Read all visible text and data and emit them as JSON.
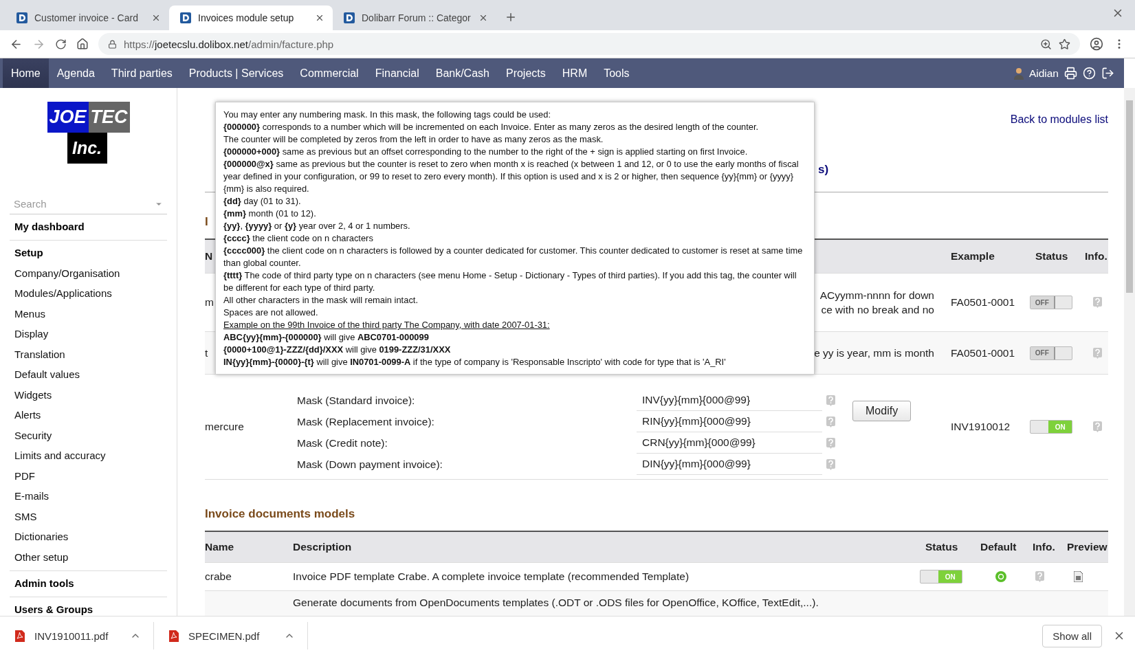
{
  "browser": {
    "tabs": [
      {
        "title": "Customer invoice - Card",
        "selected": false
      },
      {
        "title": "Invoices module setup",
        "selected": true
      },
      {
        "title": "Dolibarr Forum :: Categor",
        "selected": false
      }
    ],
    "url": {
      "scheme": "https://",
      "host": "joetecslu.dolibox.net",
      "path": "/admin/facture.php"
    }
  },
  "topmenu": {
    "items": [
      {
        "label": "Home",
        "selected": true
      },
      {
        "label": "Agenda",
        "selected": false
      },
      {
        "label": "Third parties",
        "selected": false
      },
      {
        "label": "Products | Services",
        "selected": false
      },
      {
        "label": "Commercial",
        "selected": false
      },
      {
        "label": "Financial",
        "selected": false
      },
      {
        "label": "Bank/Cash",
        "selected": false
      },
      {
        "label": "Projects",
        "selected": false
      },
      {
        "label": "HRM",
        "selected": false
      },
      {
        "label": "Tools",
        "selected": false
      }
    ],
    "user": "Aidian"
  },
  "sidebar": {
    "logo": [
      "JOE",
      "TEC",
      "Inc."
    ],
    "search_placeholder": "Search",
    "sections": [
      {
        "title": "My dashboard"
      },
      {
        "title": "Setup",
        "items": [
          "Company/Organisation",
          "Modules/Applications",
          "Menus",
          "Display",
          "Translation",
          "Default values",
          "Widgets",
          "Alerts",
          "Security",
          "Limits and accuracy",
          "PDF",
          "E-mails",
          "SMS",
          "Dictionaries",
          "Other setup"
        ]
      },
      {
        "title": "Admin tools"
      },
      {
        "title": "Users & Groups"
      }
    ]
  },
  "page": {
    "back_link": "Back to modules list",
    "tab_fragment": "s)",
    "section_fragment": "I",
    "numbering": {
      "header": {
        "name": "N",
        "example": "Example",
        "status": "Status",
        "info": "Info."
      },
      "rows": [
        {
          "name": "m",
          "description": [
            "ACyymm-nnnn for down",
            "ce with no break and no"
          ],
          "example": "FA0501-0001",
          "status": {
            "on": false,
            "label": "OFF"
          }
        },
        {
          "name": "t",
          "description": [
            "e yy is year, mm is month"
          ],
          "example": "FA0501-0001",
          "status": {
            "on": false,
            "label": "OFF"
          }
        },
        {
          "name": "mercure",
          "masks": [
            {
              "label": "Mask (Standard invoice):",
              "value": "INV{yy}{mm}{000@99}"
            },
            {
              "label": "Mask (Replacement invoice):",
              "value": "RIN{yy}{mm}{000@99}"
            },
            {
              "label": "Mask (Credit note):",
              "value": "CRN{yy}{mm}{000@99}"
            },
            {
              "label": "Mask (Down payment invoice):",
              "value": "DIN{yy}{mm}{000@99}"
            }
          ],
          "button": "Modify",
          "example": "INV1910012",
          "status": {
            "on": true,
            "label": "ON"
          }
        }
      ]
    },
    "models": {
      "title": "Invoice documents models",
      "columns": [
        "Name",
        "Description",
        "Status",
        "Default",
        "Info.",
        "Preview"
      ],
      "rows": [
        {
          "name": "crabe",
          "description": "Invoice PDF template Crabe. A complete invoice template (recommended Template)",
          "status": {
            "on": true,
            "label": "ON"
          },
          "default": true
        },
        {
          "description": "Generate documents from OpenDocuments templates (.ODT or .ODS files for OpenOffice, KOffice, TextEdit,...)."
        }
      ]
    }
  },
  "tooltip": {
    "lines": [
      {
        "kind": "plain",
        "text": "You may enter any numbering mask. In this mask, the following tags could be used:"
      },
      {
        "kind": "plain",
        "text": "**{000000}** corresponds to a number which will be incremented on each Invoice. Enter as many zeros as the desired length of the counter."
      },
      {
        "kind": "plain",
        "text": "The counter will be completed by zeros from the left in order to have as many zeros as the mask."
      },
      {
        "kind": "plain",
        "text": "**{000000+000}** same as previous but an offset corresponding to the number to the right of the + sign is applied starting on first Invoice."
      },
      {
        "kind": "plain",
        "text": "**{000000@x}** same as previous but the counter is reset to zero when month x is reached (x between 1 and 12, or 0 to use the early months of fiscal year defined in your configuration, or 99 to reset to zero every month). If this option is used and x is 2 or higher, then sequence {yy}{mm} or {yyyy}{mm} is also required."
      },
      {
        "kind": "plain",
        "text": "**{dd}** day (01 to 31)."
      },
      {
        "kind": "plain",
        "text": "**{mm}** month (01 to 12)."
      },
      {
        "kind": "plain",
        "text": "**{yy}**, **{yyyy}** or **{y}** year over 2, 4 or 1 numbers."
      },
      {
        "kind": "plain",
        "text": "**{cccc}** the client code on n characters"
      },
      {
        "kind": "plain",
        "text": "**{cccc000}** the client code on n characters is followed by a counter dedicated for customer. This counter dedicated to customer is reset at same time than global counter."
      },
      {
        "kind": "plain",
        "text": "**{tttt}** The code of third party type on n characters (see menu Home - Setup - Dictionary - Types of third parties). If you add this tag, the counter will be different for each type of third party."
      },
      {
        "kind": "plain",
        "text": "All other characters in the mask will remain intact."
      },
      {
        "kind": "plain",
        "text": "Spaces are not allowed."
      },
      {
        "kind": "underline",
        "text": "Example on the 99th Invoice of the third party The Company, with date 2007-01-31:"
      },
      {
        "kind": "plain",
        "text": "**ABC{yy}{mm}-{000000}** will give **ABC0701-000099**"
      },
      {
        "kind": "plain",
        "text": "**{0000+100@1}-ZZZ/{dd}/XXX** will give **0199-ZZZ/31/XXX**"
      },
      {
        "kind": "plain",
        "text": "**IN{yy}{mm}-{0000}-{t}** will give **IN0701-0099-A** if the type of company is 'Responsable Inscripto' with code for type that is 'A_RI'"
      }
    ]
  },
  "downloads": {
    "items": [
      "INV1910011.pdf",
      "SPECIMEN.pdf"
    ],
    "show_all": "Show all"
  }
}
